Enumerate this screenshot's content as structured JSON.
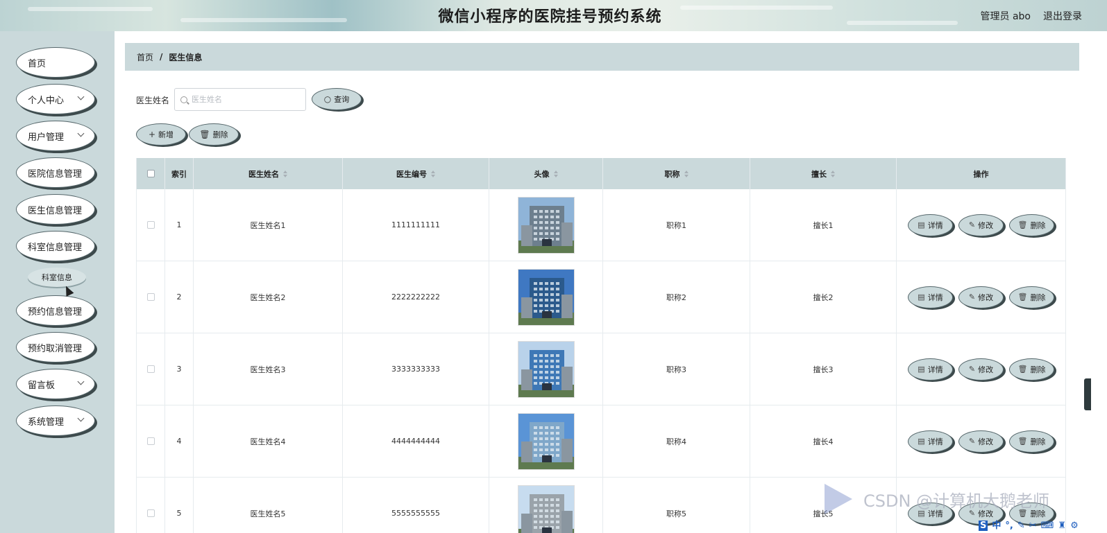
{
  "header": {
    "title": "微信小程序的医院挂号预约系统",
    "admin": "管理员 abo",
    "logout": "退出登录"
  },
  "sidebar": {
    "items": [
      {
        "label": "首页",
        "has_arrow": false
      },
      {
        "label": "个人中心",
        "has_arrow": true
      },
      {
        "label": "用户管理",
        "has_arrow": true
      },
      {
        "label": "医院信息管理",
        "has_arrow": false
      },
      {
        "label": "医生信息管理",
        "has_arrow": false
      },
      {
        "label": "科室信息管理",
        "has_arrow": false
      },
      {
        "label": "预约信息管理",
        "has_arrow": false
      },
      {
        "label": "预约取消管理",
        "has_arrow": false
      },
      {
        "label": "留言板",
        "has_arrow": true
      },
      {
        "label": "系统管理",
        "has_arrow": true
      }
    ],
    "sub_item": "科室信息"
  },
  "breadcrumb": {
    "home": "首页",
    "sep": "/",
    "current": "医生信息"
  },
  "search": {
    "label": "医生姓名",
    "placeholder": "医生姓名",
    "value": "",
    "button": "查询"
  },
  "actions": {
    "add": "新增",
    "delete": "删除"
  },
  "table": {
    "columns": [
      "索引",
      "医生姓名",
      "医生编号",
      "头像",
      "职称",
      "擅长",
      "操作"
    ],
    "rows": [
      {
        "index": "1",
        "name": "医生姓名1",
        "code": "1111111111",
        "title": "职称1",
        "skill": "擅长1"
      },
      {
        "index": "2",
        "name": "医生姓名2",
        "code": "2222222222",
        "title": "职称2",
        "skill": "擅长2"
      },
      {
        "index": "3",
        "name": "医生姓名3",
        "code": "3333333333",
        "title": "职称3",
        "skill": "擅长3"
      },
      {
        "index": "4",
        "name": "医生姓名4",
        "code": "4444444444",
        "title": "职称4",
        "skill": "擅长4"
      },
      {
        "index": "5",
        "name": "医生姓名5",
        "code": "5555555555",
        "title": "职称5",
        "skill": "擅长5"
      }
    ],
    "row_actions": {
      "detail": "详情",
      "edit": "修改",
      "delete": "删除"
    }
  },
  "watermark": "CSDN @计算机大鹅老师",
  "tray": {
    "ime": "中"
  },
  "colors": {
    "sidebar_bg": "#cad9db",
    "button_shadow": "#3d4a4c",
    "header_gradient_accent": "#9fc1c6"
  }
}
